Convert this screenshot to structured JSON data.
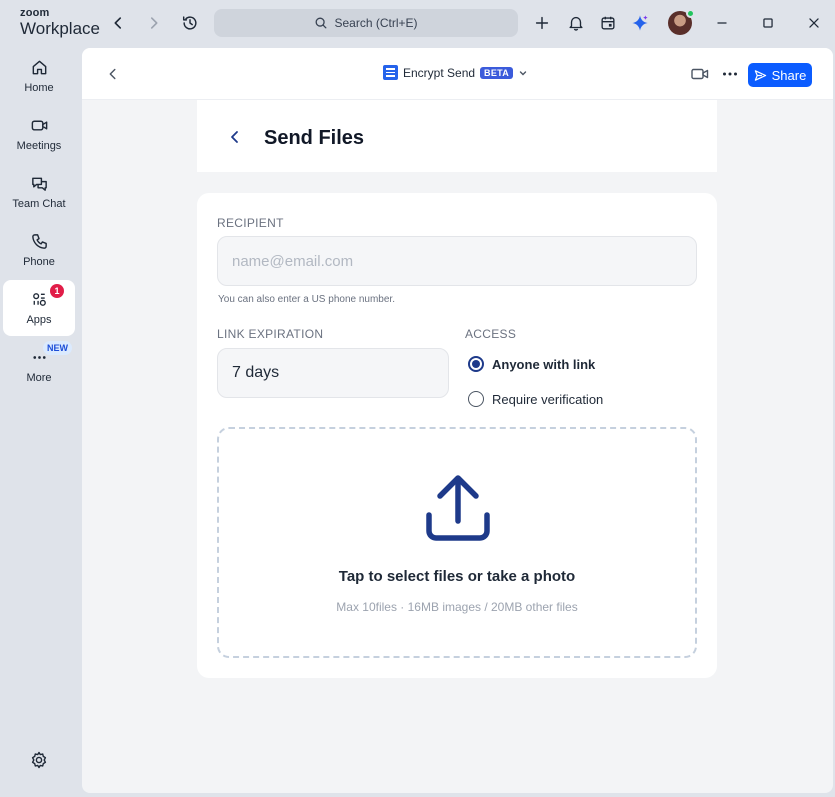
{
  "app": {
    "brand_top": "zoom",
    "brand_bottom": "Workplace"
  },
  "titlebar": {
    "search_label": "Search (Ctrl+E)"
  },
  "sidebar": {
    "items": [
      {
        "label": "Home"
      },
      {
        "label": "Meetings"
      },
      {
        "label": "Team Chat"
      },
      {
        "label": "Phone"
      },
      {
        "label": "Apps",
        "badge": "1"
      },
      {
        "label": "More",
        "badge": "NEW"
      }
    ]
  },
  "topbar": {
    "app_name": "Encrypt Send",
    "beta_label": "BETA",
    "share_label": "Share"
  },
  "page": {
    "title": "Send Files"
  },
  "form": {
    "recipient_label": "RECIPIENT",
    "recipient_placeholder": "name@email.com",
    "recipient_value": "",
    "recipient_hint": "You can also enter a US phone number.",
    "expiration_label": "LINK EXPIRATION",
    "expiration_value": "7 days",
    "access_label": "ACCESS",
    "access_options": [
      {
        "label": "Anyone with link",
        "selected": true
      },
      {
        "label": "Require verification",
        "selected": false
      }
    ],
    "dropzone_title": "Tap to select files or take a photo",
    "dropzone_subtitle": "Max 10files · 16MB images / 20MB other files"
  },
  "colors": {
    "accent": "#0b5cff",
    "primary_dark": "#1e3a8a",
    "badge_red": "#e11d48"
  }
}
